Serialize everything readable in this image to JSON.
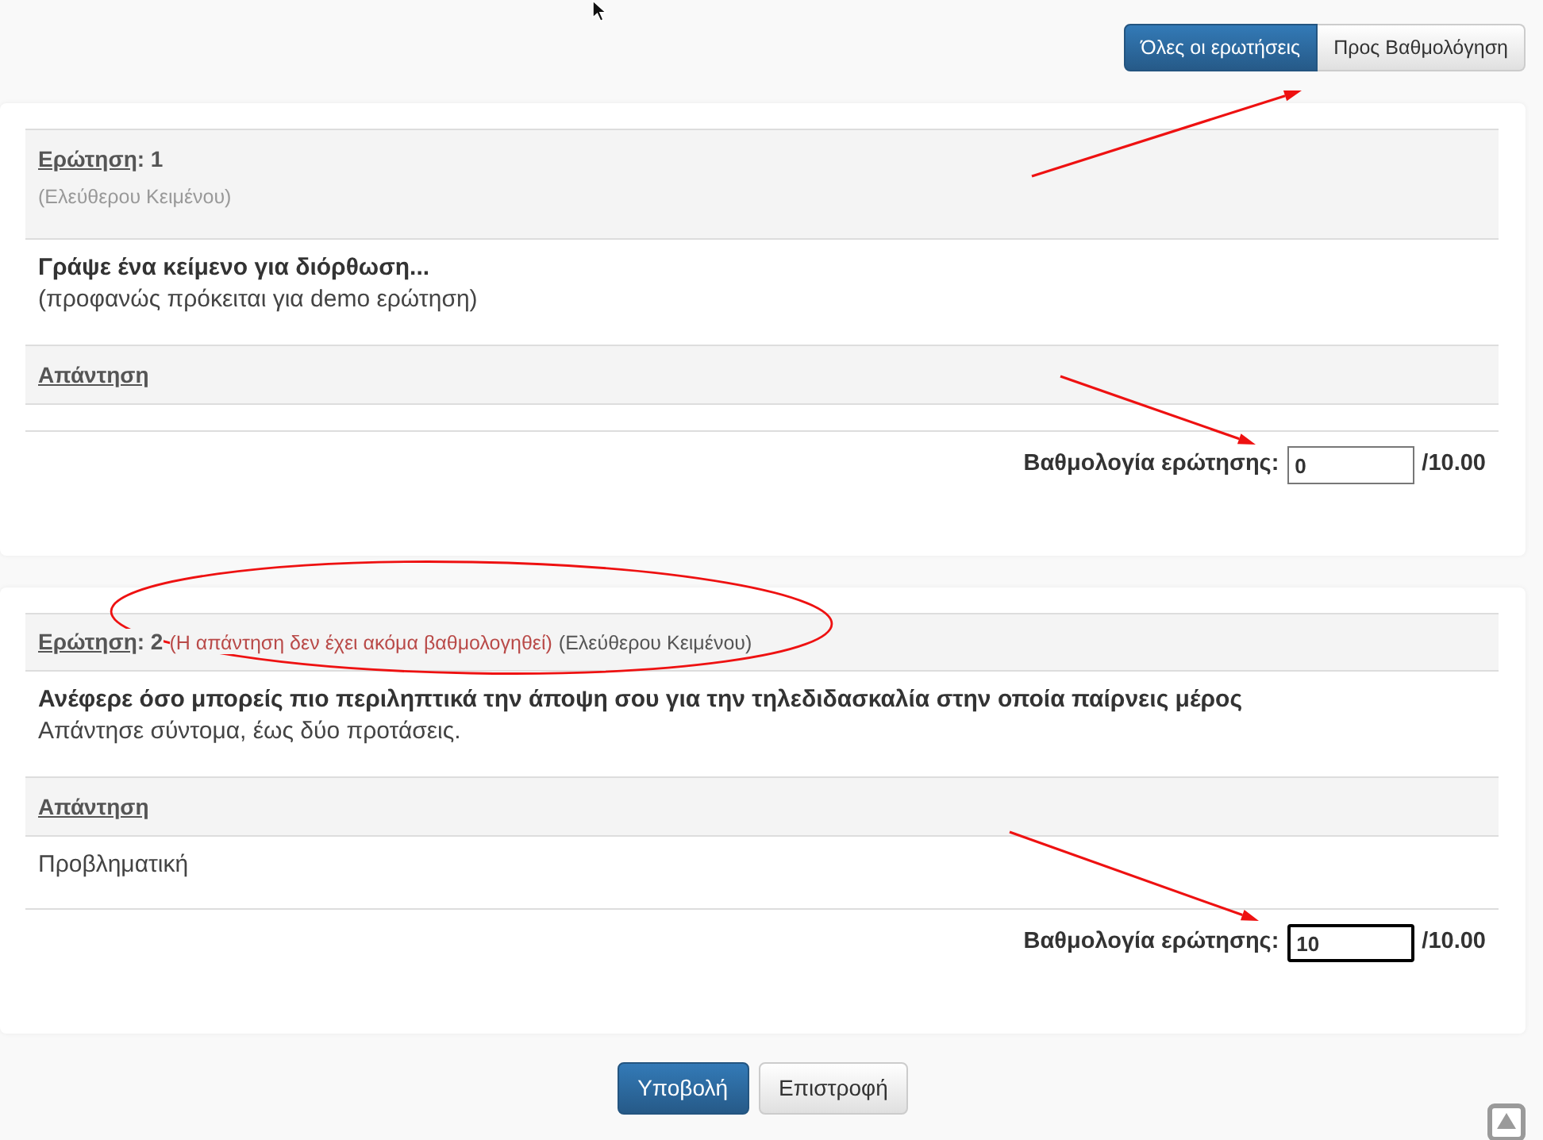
{
  "view_filter": [
    {
      "label": "Όλες οι ερωτήσεις",
      "selected": true
    },
    {
      "label": "Προς Βαθμολόγηση",
      "selected": false
    }
  ],
  "questions": [
    {
      "header": {
        "kind": "stacked",
        "label": "Ερώτηση",
        "number": ": 1",
        "type": "(Ελεύθερου Κειμένου)"
      },
      "text": "Γράψε ένα κείμενο για διόρθωση...",
      "note": "(προφανώς πρόκειται για demo ερώτηση)",
      "answer_heading": "Απάντηση",
      "score": {
        "label": "Βαθμολογία ερώτησης:",
        "value": "0",
        "max": "/10.00",
        "focused": false
      }
    },
    {
      "header": {
        "kind": "inline",
        "label": "Ερώτηση",
        "number": ": 2",
        "status": "(Η απάντηση δεν έχει ακόμα βαθμολογηθεί)",
        "type": "(Ελεύθερου Κειμένου)"
      },
      "text": "Ανέφερε όσο μπορείς πιο περιληπτικά την άποψη σου για την τηλεδιδασκαλία στην οποία παίρνεις μέρος",
      "note": "Απάντησε σύντομα, έως δύο προτάσεις.",
      "answer_heading": "Απάντηση",
      "answer": "Προβληματική",
      "score": {
        "label": "Βαθμολογία ερώτησης:",
        "value": "10",
        "max": "/10.00",
        "focused": true
      }
    }
  ],
  "actions": [
    {
      "label": "Υποβολή",
      "kind": "primary"
    },
    {
      "label": "Επιστροφή",
      "kind": "default"
    }
  ]
}
